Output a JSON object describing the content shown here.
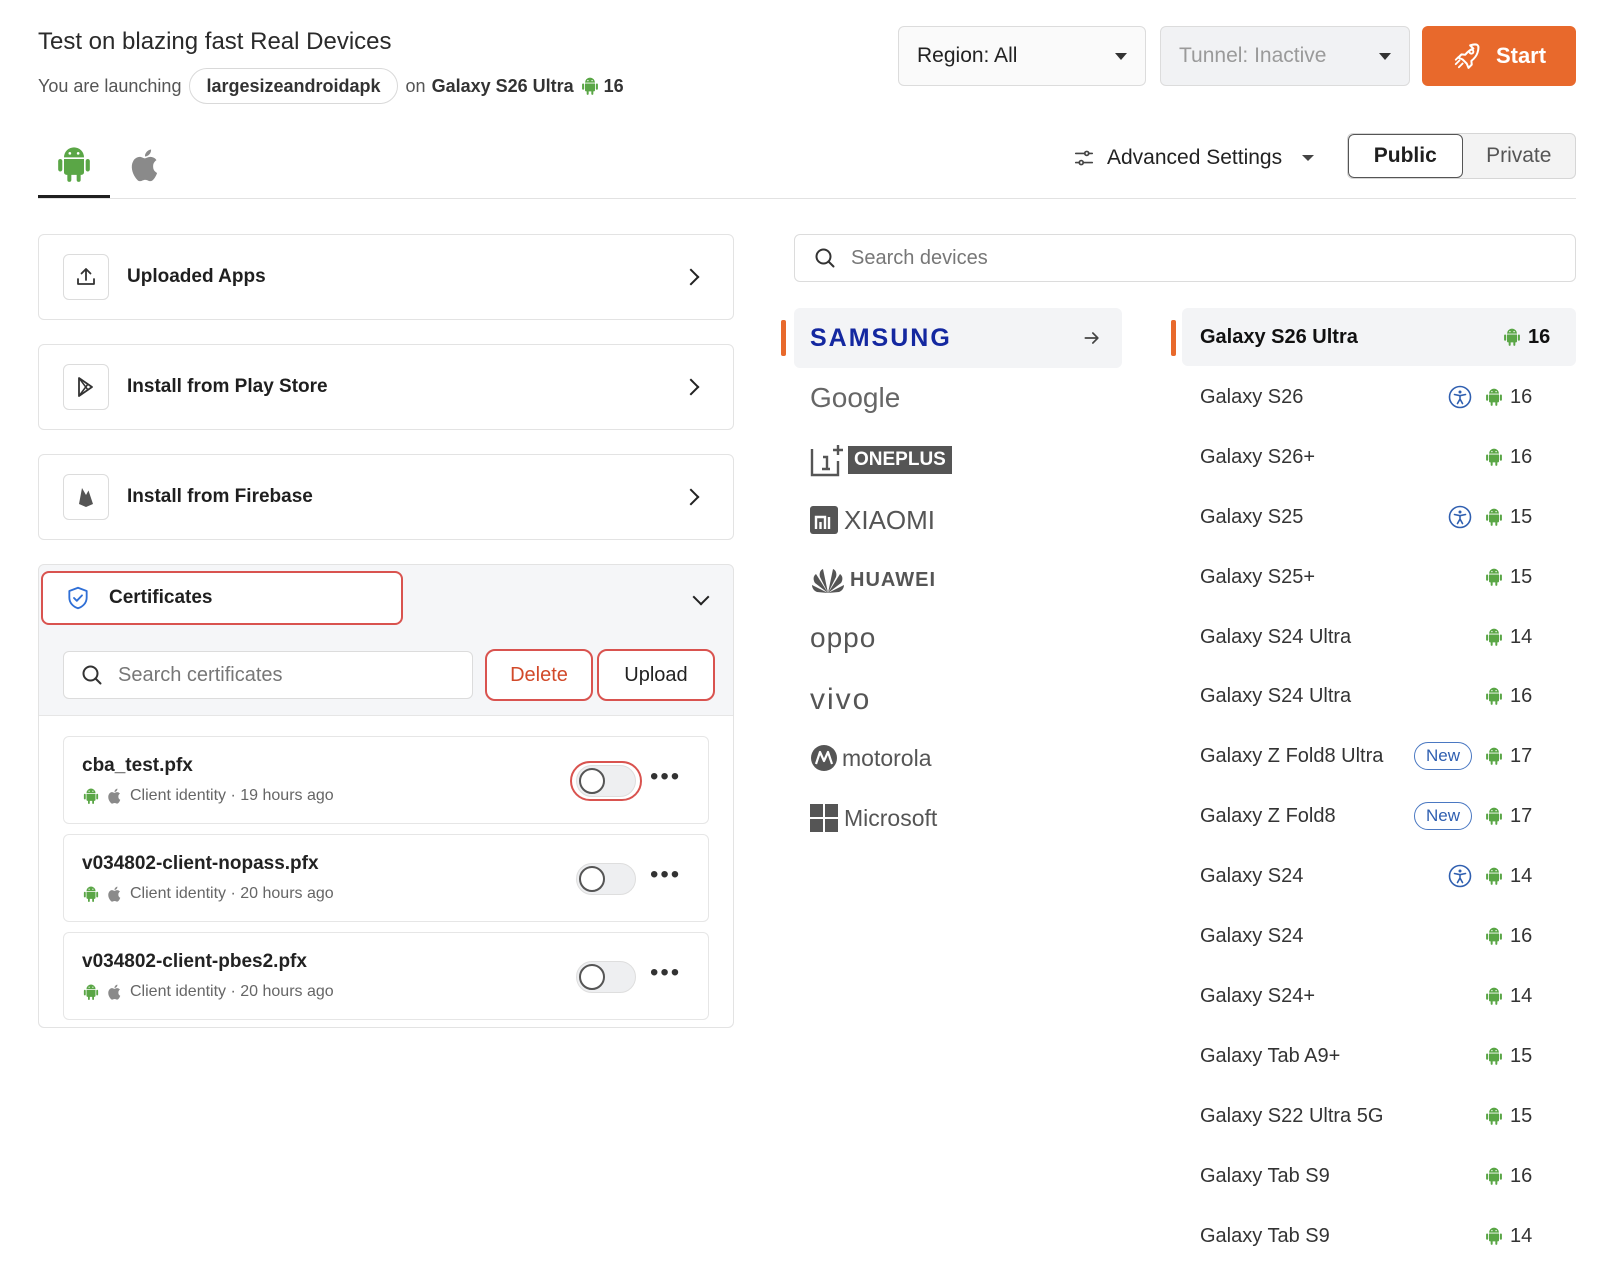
{
  "header": {
    "title": "Test on blazing fast Real Devices",
    "launch_prefix": "You are launching",
    "app_name": "largesizeandroidapk",
    "on_text": "on",
    "device": "Galaxy S26 Ultra",
    "version": "16"
  },
  "controls": {
    "region": "Region: All",
    "tunnel": "Tunnel: Inactive",
    "start": "Start",
    "advanced": "Advanced Settings",
    "visibility": [
      "Public",
      "Private"
    ],
    "visibility_selected": "Public"
  },
  "left": {
    "cards": [
      {
        "label": "Uploaded Apps",
        "icon": "upload-icon"
      },
      {
        "label": "Install from Play Store",
        "icon": "play-store-icon"
      },
      {
        "label": "Install from Firebase",
        "icon": "firebase-icon"
      }
    ],
    "certificates": {
      "title": "Certificates",
      "search_placeholder": "Search certificates",
      "delete": "Delete",
      "upload": "Upload",
      "items": [
        {
          "name": "cba_test.pfx",
          "meta": "Client identity · 19 hours ago"
        },
        {
          "name": "v034802-client-nopass.pfx",
          "meta": "Client identity · 20 hours ago"
        },
        {
          "name": "v034802-client-pbes2.pfx",
          "meta": "Client identity · 20 hours ago"
        }
      ]
    }
  },
  "right": {
    "search_placeholder": "Search devices",
    "brands": [
      "SAMSUNG",
      "Google",
      "ONEPLUS",
      "XIAOMI",
      "HUAWEI",
      "oppo",
      "vivo",
      "motorola",
      "Microsoft"
    ],
    "devices": [
      {
        "name": "Galaxy S26 Ultra",
        "version": "16",
        "accessibility": false,
        "new": false
      },
      {
        "name": "Galaxy S26",
        "version": "16",
        "accessibility": true,
        "new": false
      },
      {
        "name": "Galaxy S26+",
        "version": "16",
        "accessibility": false,
        "new": false
      },
      {
        "name": "Galaxy S25",
        "version": "15",
        "accessibility": true,
        "new": false
      },
      {
        "name": "Galaxy S25+",
        "version": "15",
        "accessibility": false,
        "new": false
      },
      {
        "name": "Galaxy S24 Ultra",
        "version": "14",
        "accessibility": false,
        "new": false
      },
      {
        "name": "Galaxy S24 Ultra",
        "version": "16",
        "accessibility": false,
        "new": false
      },
      {
        "name": "Galaxy Z Fold8 Ultra",
        "version": "17",
        "accessibility": false,
        "new": true
      },
      {
        "name": "Galaxy Z Fold8",
        "version": "17",
        "accessibility": false,
        "new": true
      },
      {
        "name": "Galaxy S24",
        "version": "14",
        "accessibility": true,
        "new": false
      },
      {
        "name": "Galaxy S24",
        "version": "16",
        "accessibility": false,
        "new": false
      },
      {
        "name": "Galaxy S24+",
        "version": "14",
        "accessibility": false,
        "new": false
      },
      {
        "name": "Galaxy Tab A9+",
        "version": "15",
        "accessibility": false,
        "new": false
      },
      {
        "name": "Galaxy S22 Ultra 5G",
        "version": "15",
        "accessibility": false,
        "new": false
      },
      {
        "name": "Galaxy Tab S9",
        "version": "16",
        "accessibility": false,
        "new": false
      },
      {
        "name": "Galaxy Tab S9",
        "version": "14",
        "accessibility": false,
        "new": false
      }
    ],
    "new_badge": "New"
  },
  "colors": {
    "accent": "#e8692c",
    "android": "#5aa646",
    "danger": "#d9534f",
    "link": "#2f5fb0"
  }
}
